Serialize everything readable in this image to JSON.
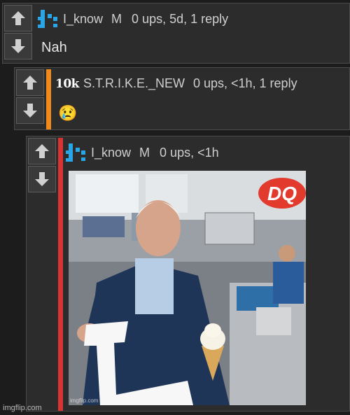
{
  "comments": [
    {
      "username": "I_know",
      "flag": "M",
      "stats": "0 ups, 5d, 1 reply",
      "body": "Nah",
      "avatar_icon": "pixel-avatar-icon",
      "accent": ""
    },
    {
      "badge": "10k",
      "username": "S.T.R.I.K.E._NEW",
      "stats": "0 ups, <1h, 1 reply",
      "body": "😢",
      "accent": "#f08a1c"
    },
    {
      "username": "I_know",
      "flag": "M",
      "stats": "0 ups, <1h",
      "avatar_icon": "pixel-avatar-icon",
      "accent": "#d93434",
      "image": {
        "logo_text": "DQ",
        "watermark": "imgflip.com"
      }
    }
  ],
  "icons": {
    "upvote": "arrow-up-icon",
    "downvote": "arrow-down-icon"
  },
  "footer": {
    "watermark": "imgflip.com"
  }
}
